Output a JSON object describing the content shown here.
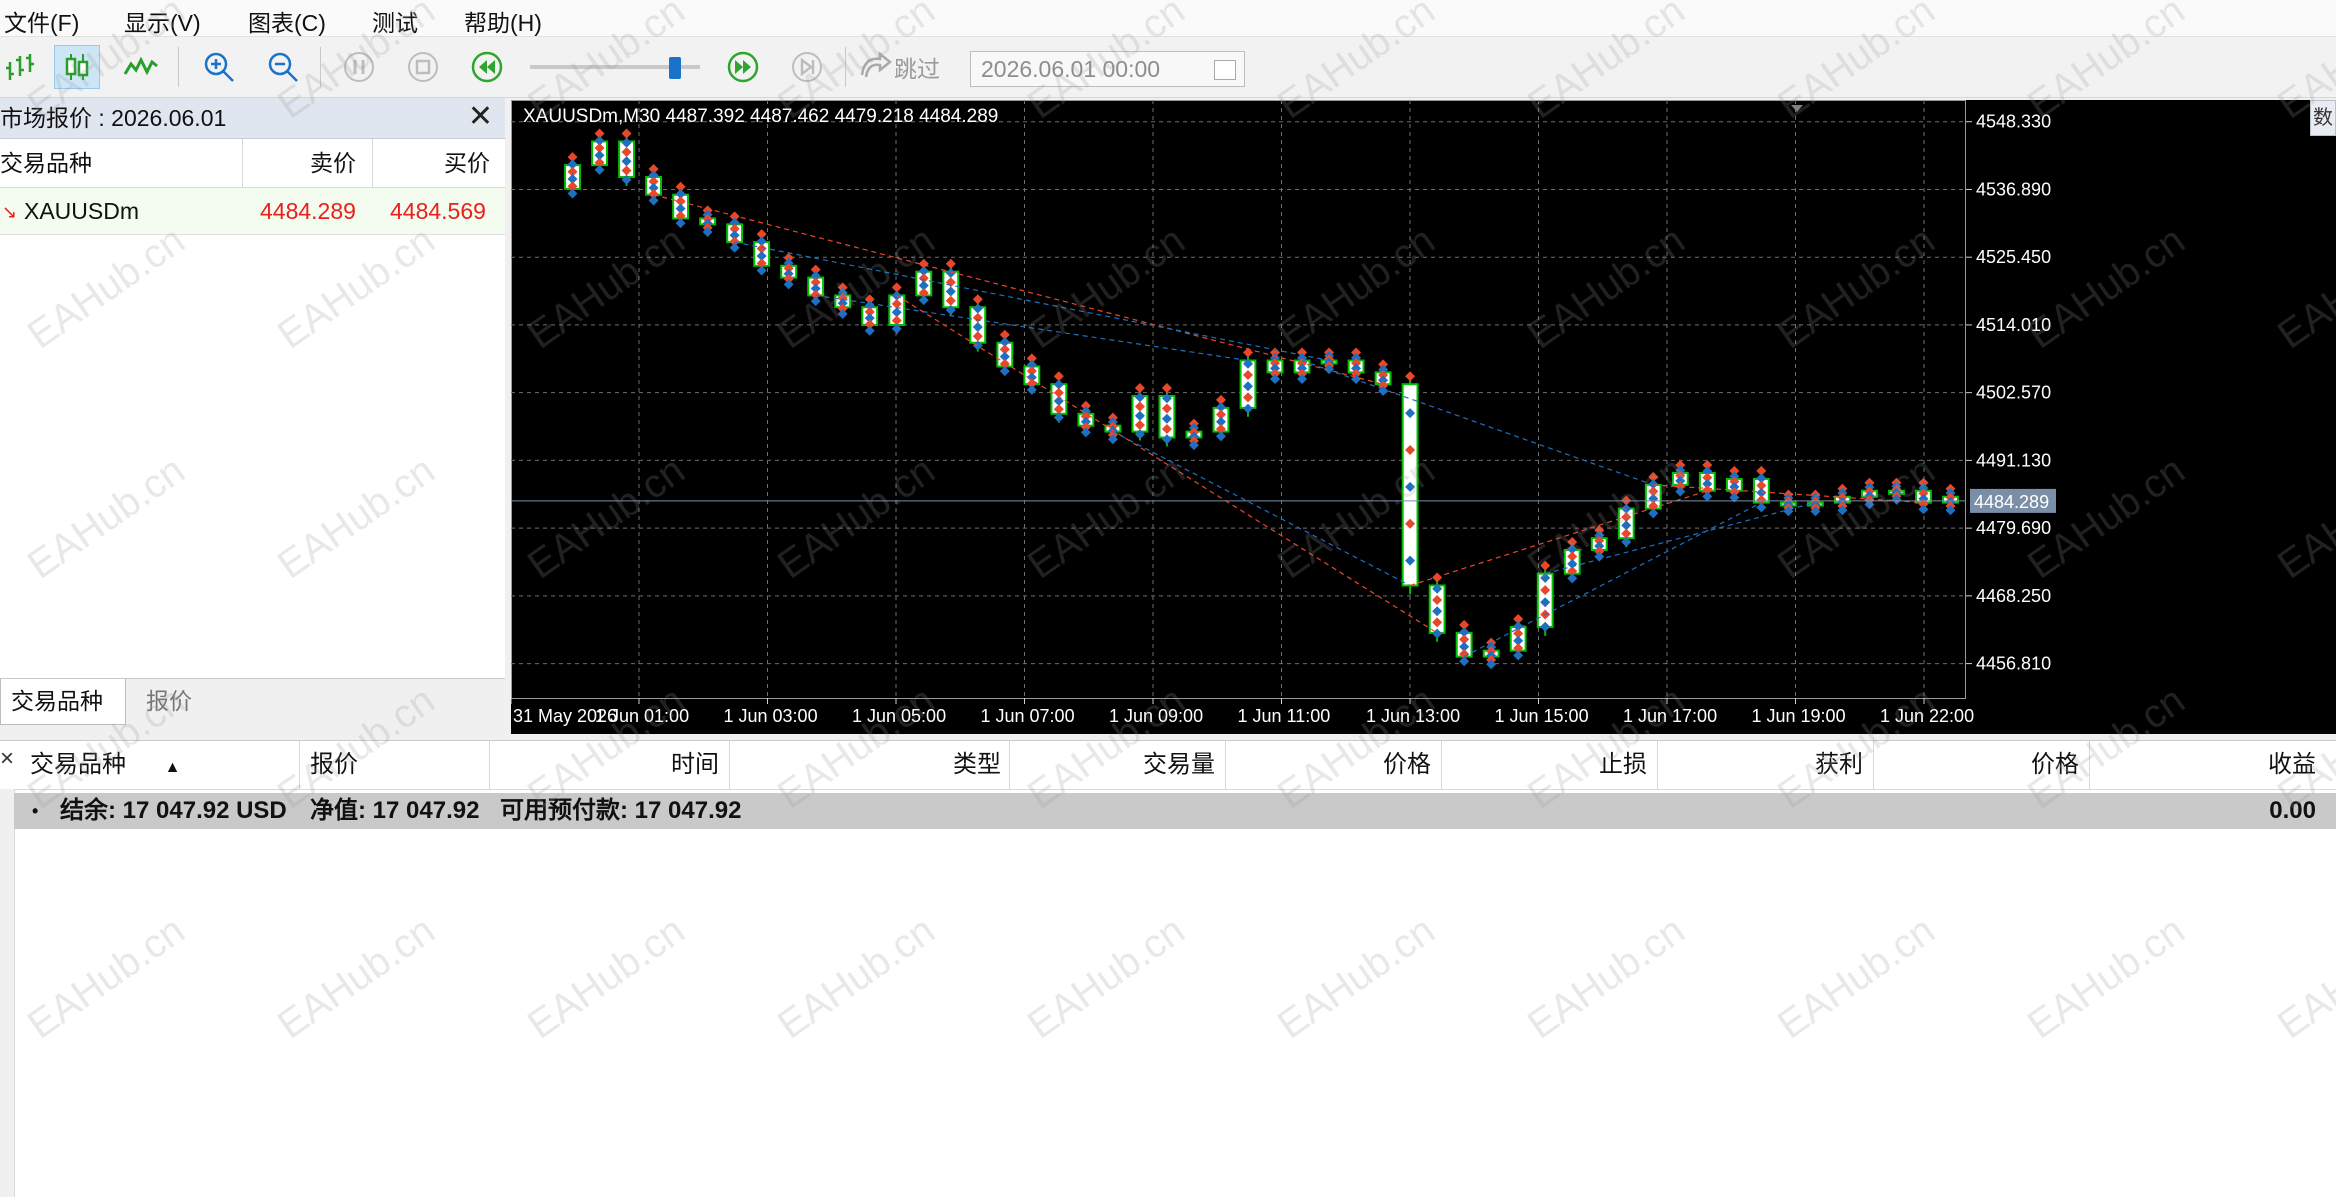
{
  "menu": [
    "文件(F)",
    "显示(V)",
    "图表(C)",
    "测试",
    "帮助(H)"
  ],
  "toolbar": {
    "icons": [
      "bar-chart-icon",
      "candlestick-chart-icon",
      "line-chart-icon",
      "zoom-in-icon",
      "zoom-out-icon",
      "pause-icon",
      "stop-icon",
      "rewind-icon",
      "fast-forward-icon",
      "step-forward-icon",
      "skip-icon"
    ],
    "active_chart_type": "candlestick",
    "speed_level": 0.88,
    "skip_label": "跳过",
    "date_value": "2026.06.01 00:00"
  },
  "market_watch": {
    "title": "市场报价 : 2026.06.01",
    "columns": {
      "symbol": "交易品种",
      "bid": "卖价",
      "ask": "买价"
    },
    "rows": [
      {
        "symbol": "XAUUSDm",
        "bid": "4484.289",
        "ask": "4484.569"
      }
    ],
    "tabs": [
      "交易品种",
      "报价"
    ],
    "colors": {
      "price": "#e8211c",
      "row_bg": "#f4fbef"
    }
  },
  "chart": {
    "info_line": "XAUUSDm,M30  4487.392 4487.462 4479.218 4484.289",
    "current_price_label": "4484.289",
    "price_ticks": [
      "4548.330",
      "4536.890",
      "4525.450",
      "4514.010",
      "4502.570",
      "4491.130",
      "4479.690",
      "4468.250",
      "4456.810"
    ],
    "time_ticks": [
      "31 May 2026",
      "1 Jun 01:00",
      "1 Jun 03:00",
      "1 Jun 05:00",
      "1 Jun 07:00",
      "1 Jun 09:00",
      "1 Jun 11:00",
      "1 Jun 13:00",
      "1 Jun 15:00",
      "1 Jun 17:00",
      "1 Jun 19:00",
      "1 Jun 22:00"
    ],
    "right_tab_label": "数",
    "colors": {
      "background": "#000000",
      "grid": "#6f6f6f",
      "candle_up": "#00c000",
      "candle_body": "#ffffff",
      "buy_marker": "#1f6fc0",
      "sell_marker": "#e8472a"
    }
  },
  "chart_data": {
    "type": "candlestick",
    "symbol": "XAUUSDm",
    "timeframe": "M30",
    "ylim": [
      4451.0,
      4552.0
    ],
    "current_price": 4484.289,
    "grid": true,
    "close": [
      4541,
      4545,
      4539,
      4536,
      4532,
      4531,
      4528,
      4524,
      4522,
      4519,
      4517,
      4514,
      4519,
      4523,
      4517,
      4511,
      4507,
      4504,
      4499,
      4497,
      4496,
      4502,
      4495,
      4496,
      4500,
      4508,
      4506,
      4508,
      4508,
      4506,
      4504,
      4470,
      4462,
      4458,
      4459,
      4463,
      4472,
      4476,
      4478,
      4483,
      4487,
      4489,
      4486,
      4488,
      4484,
      4484,
      4484,
      4485,
      4486,
      4486,
      4484,
      4485
    ]
  },
  "terminal": {
    "columns": [
      "交易品种",
      "报价",
      "时间",
      "类型",
      "交易量",
      "价格",
      "止损",
      "获利",
      "价格",
      "收益"
    ],
    "balance_label": "结余: 17 047.92 USD",
    "equity_label": "净值: 17 047.92",
    "margin_label": "可用预付款: 17 047.92",
    "profit_value": "0.00"
  },
  "watermark_text": "EAHub.cn"
}
